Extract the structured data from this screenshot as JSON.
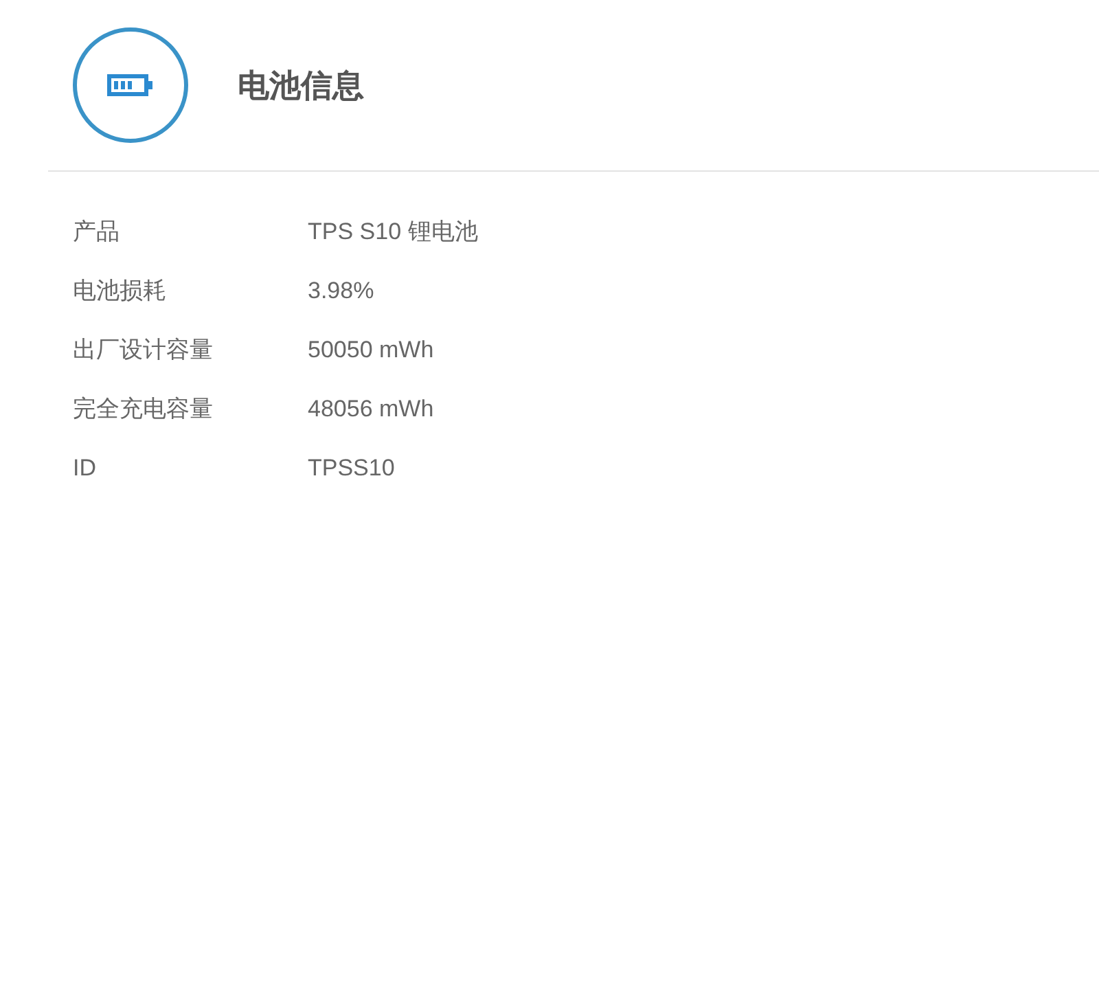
{
  "header": {
    "title": "电池信息"
  },
  "details": [
    {
      "label": "产品",
      "value": "TPS S10 锂电池"
    },
    {
      "label": "电池损耗",
      "value": "3.98%"
    },
    {
      "label": "出厂设计容量",
      "value": "50050 mWh"
    },
    {
      "label": "完全充电容量",
      "value": "48056 mWh"
    },
    {
      "label": "ID",
      "value": "TPSS10"
    }
  ]
}
